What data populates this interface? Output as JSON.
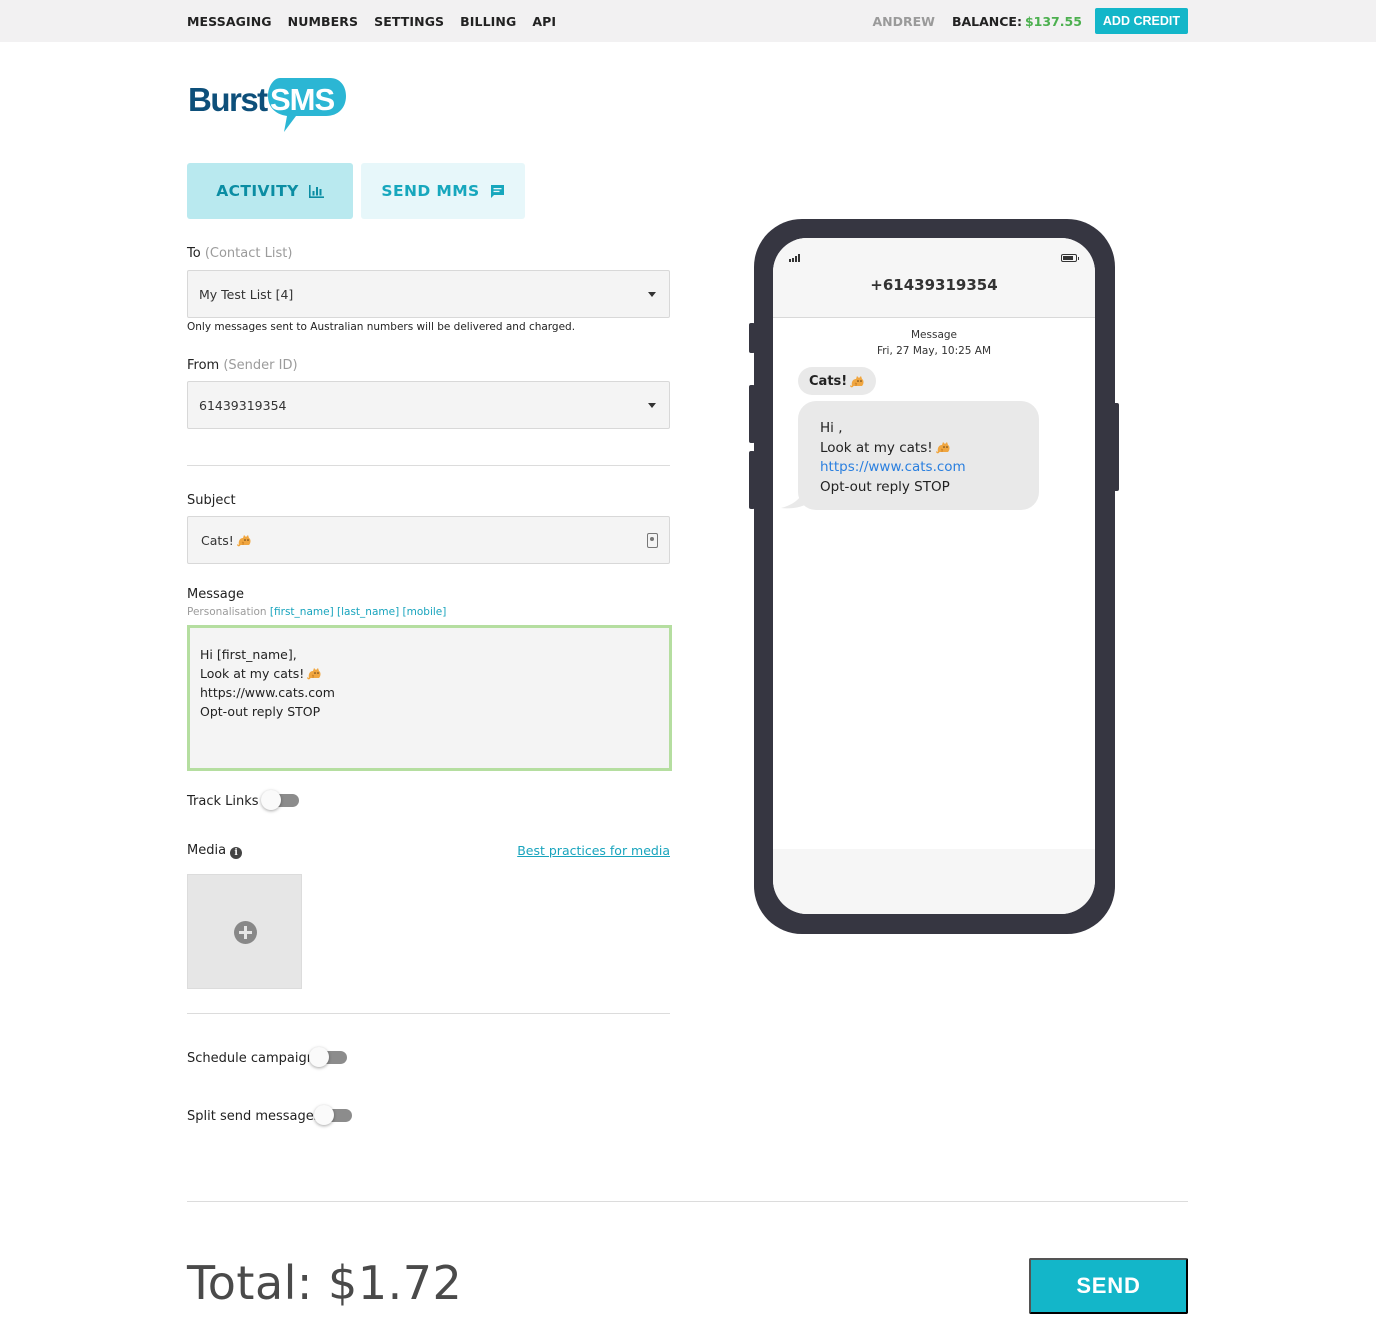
{
  "topbar": {
    "nav": [
      "MESSAGING",
      "NUMBERS",
      "SETTINGS",
      "BILLING",
      "API"
    ],
    "username": "ANDREW",
    "balance_label": "BALANCE:",
    "balance_value": "$137.55",
    "add_credit": "ADD CREDIT"
  },
  "logo": {
    "word1": "Burst",
    "word2": "SMS"
  },
  "tabs": {
    "activity": "ACTIVITY",
    "send_mms": "SEND MMS"
  },
  "form": {
    "to_label": "To",
    "to_hint": "(Contact List)",
    "to_value": "My Test List [4]",
    "to_note": "Only messages sent to Australian numbers will be delivered and charged.",
    "from_label": "From",
    "from_hint": "(Sender ID)",
    "from_value": "61439319354",
    "subject_label": "Subject",
    "subject_value": "Cats!",
    "message_label": "Message",
    "personalisation_label": "Personalisation",
    "personalisation_tags": [
      "[first_name]",
      "[last_name]",
      "[mobile]"
    ],
    "message_lines": [
      "Hi [first_name],",
      "Look at my cats!",
      "https://www.cats.com",
      "Opt-out reply STOP"
    ],
    "track_links_label": "Track Links",
    "track_links_on": false,
    "media_label": "Media",
    "best_practices_link": "Best practices for media",
    "schedule_label": "Schedule campaign",
    "schedule_on": false,
    "split_label": "Split send messages",
    "split_on": false
  },
  "footer": {
    "total": "Total: $1.72",
    "send": "SEND"
  },
  "phone": {
    "number": "+61439319354",
    "meta_title": "Message",
    "meta_time": "Fri, 27 May, 10:25 AM",
    "subject": "Cats!",
    "lines": [
      "Hi ,",
      "Look at my cats!",
      "https://www.cats.com",
      "Opt-out reply STOP"
    ]
  },
  "colors": {
    "accent": "#13b6c9",
    "balance": "#4cb04f",
    "phone_frame": "#363641",
    "textarea_border": "#b5dea0"
  },
  "icons": [
    "bar-chart-icon",
    "message-icon",
    "caret-down-icon",
    "contact-card-icon",
    "info-icon",
    "add-circle-icon",
    "cat-emoji",
    "signal-icon",
    "battery-icon"
  ]
}
